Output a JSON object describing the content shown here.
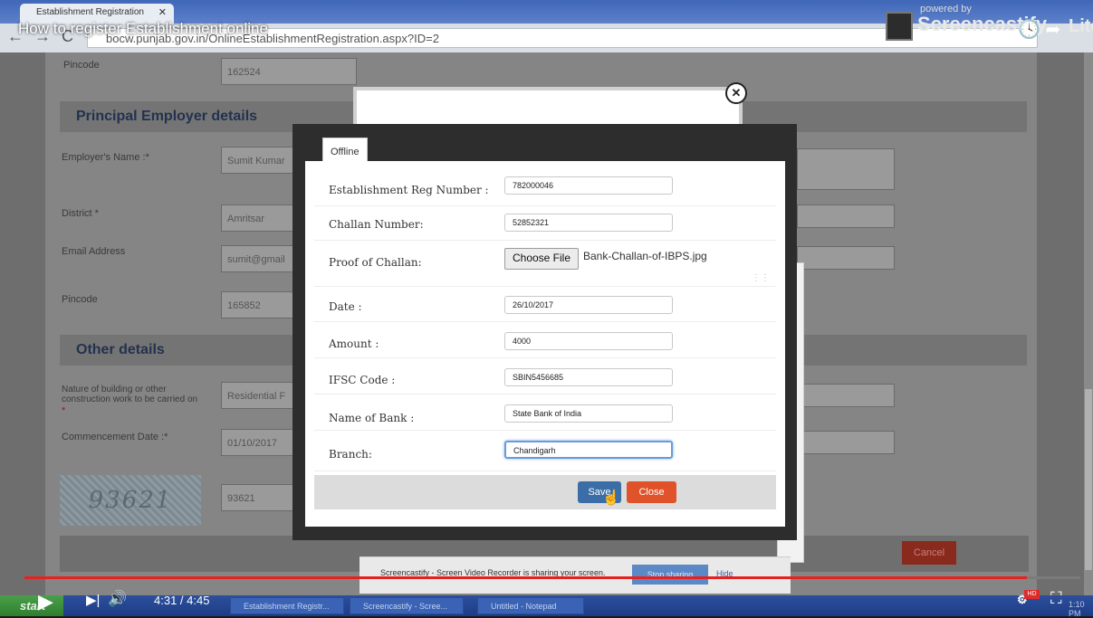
{
  "video": {
    "title": "How to register Establishment online",
    "time": "4:31 / 4:45",
    "progress_fraction": 0.949,
    "watermark_powered": "powered by",
    "watermark_name": "Screencastify",
    "watermark_suffix": "Lite"
  },
  "browser": {
    "tab_title": "Establishment Registration",
    "url": "bocw.punjab.gov.in/OnlineEstablishmentRegistration.aspx?ID=2"
  },
  "page": {
    "pincode_top_label": "Pincode",
    "pincode_top_value": "162524",
    "section_principal": "Principal Employer details",
    "employer_name_label": "Employer's Name :*",
    "employer_name_value": "Sumit Kumar",
    "district_label": "District *",
    "district_value": "Amritsar",
    "email_label": "Email Address",
    "email_value": "sumit@gmail",
    "pincode_label": "Pincode",
    "pincode_value": "165852",
    "section_other": "Other details",
    "nature_label": "Nature of building or other construction work to be carried on",
    "nature_required": "*",
    "nature_value": "Residential F",
    "commencement_label": "Commencement Date :*",
    "commencement_value": "01/10/2017",
    "captcha_text": "93621",
    "captcha_input": "93621",
    "cancel_label": "Cancel"
  },
  "modal": {
    "tab_label": "Offline",
    "fields": [
      {
        "label": "Establishment Reg Number :",
        "value": "782000046"
      },
      {
        "label": "Challan Number:",
        "value": "52852321"
      },
      {
        "label": "Proof of Challan:",
        "value": ""
      },
      {
        "label": "Date :",
        "value": "26/10/2017"
      },
      {
        "label": "Amount :",
        "value": "4000"
      },
      {
        "label": "IFSC Code :",
        "value": "SBIN5456685"
      },
      {
        "label": "Name of Bank :",
        "value": "State Bank of India"
      },
      {
        "label": "Branch:",
        "value": "Chandigarh"
      }
    ],
    "choose_file_label": "Choose File",
    "file_name": "Bank-Challan-of-IBPS.jpg",
    "save_label": "Save",
    "close_label": "Close"
  },
  "screencastify_bar": {
    "message": "Screencastify - Screen Video Recorder is sharing your screen.",
    "stop_label": "Stop sharing",
    "hide_label": "Hide"
  },
  "taskbar": {
    "start_label": "start",
    "tasks": [
      "Establishment Registr...",
      "Screencastify - Scree...",
      "Untitled - Notepad"
    ],
    "hd_badge": "HD",
    "clock": "1:10 PM"
  }
}
